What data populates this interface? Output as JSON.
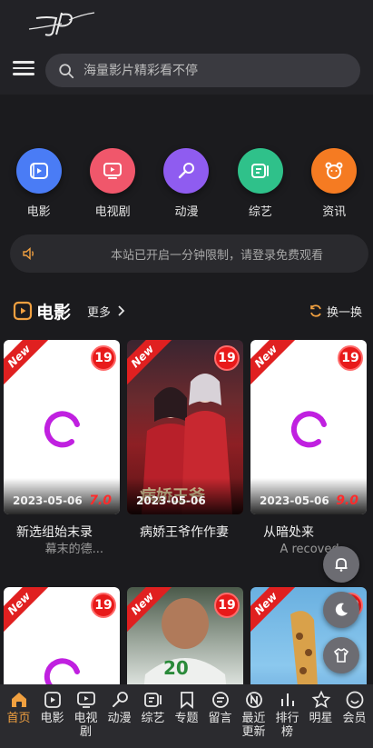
{
  "header": {
    "search_placeholder": "海量影片精彩看不停"
  },
  "categories": [
    {
      "label": "电影",
      "icon": "movie-icon",
      "color": "#4a7cf5"
    },
    {
      "label": "电视剧",
      "icon": "tv-icon",
      "color": "#f0576b"
    },
    {
      "label": "动漫",
      "icon": "brush-icon",
      "color": "#8f5cf0"
    },
    {
      "label": "综艺",
      "icon": "variety-icon",
      "color": "#2fc18a"
    },
    {
      "label": "资讯",
      "icon": "news-icon",
      "color": "#f57b22"
    }
  ],
  "notice": {
    "text": "本站已开启一分钟限制，请登录免费观看"
  },
  "section": {
    "title": "电影",
    "more_label": "更多",
    "refresh_label": "换一换"
  },
  "cards": [
    {
      "ribbon": "New",
      "age": "19",
      "date": "2023-05-06",
      "score": "7.0",
      "title": "新选组始末录",
      "subtitle": "幕末的德..."
    },
    {
      "ribbon": "New",
      "age": "19",
      "date": "2023-05-06",
      "score": "",
      "title": "病娇王爷作作妻",
      "subtitle": ""
    },
    {
      "ribbon": "New",
      "age": "19",
      "date": "2023-05-06",
      "score": "9.0",
      "title": "从暗处来",
      "subtitle": "A recoved..."
    },
    {
      "ribbon": "New",
      "age": "19"
    },
    {
      "ribbon": "New",
      "age": "19"
    },
    {
      "ribbon": "New",
      "age": "19"
    }
  ],
  "tabbar": [
    {
      "label": "首页",
      "icon": "home-icon",
      "active": true
    },
    {
      "label": "电影",
      "icon": "movie-icon"
    },
    {
      "label": "电视剧",
      "icon": "tv-icon"
    },
    {
      "label": "动漫",
      "icon": "brush-icon"
    },
    {
      "label": "综艺",
      "icon": "variety-icon"
    },
    {
      "label": "专题",
      "icon": "bookmark-icon"
    },
    {
      "label": "留言",
      "icon": "message-icon"
    },
    {
      "label": "最近更新",
      "icon": "new-icon"
    },
    {
      "label": "排行榜",
      "icon": "chart-icon"
    },
    {
      "label": "明星",
      "icon": "star-icon"
    },
    {
      "label": "会员",
      "icon": "user-icon"
    }
  ],
  "colors": {
    "accent": "#f0a040",
    "badge_red": "#e81a1a",
    "score_red": "#ff2b2b",
    "spinner": "#c020e0"
  }
}
